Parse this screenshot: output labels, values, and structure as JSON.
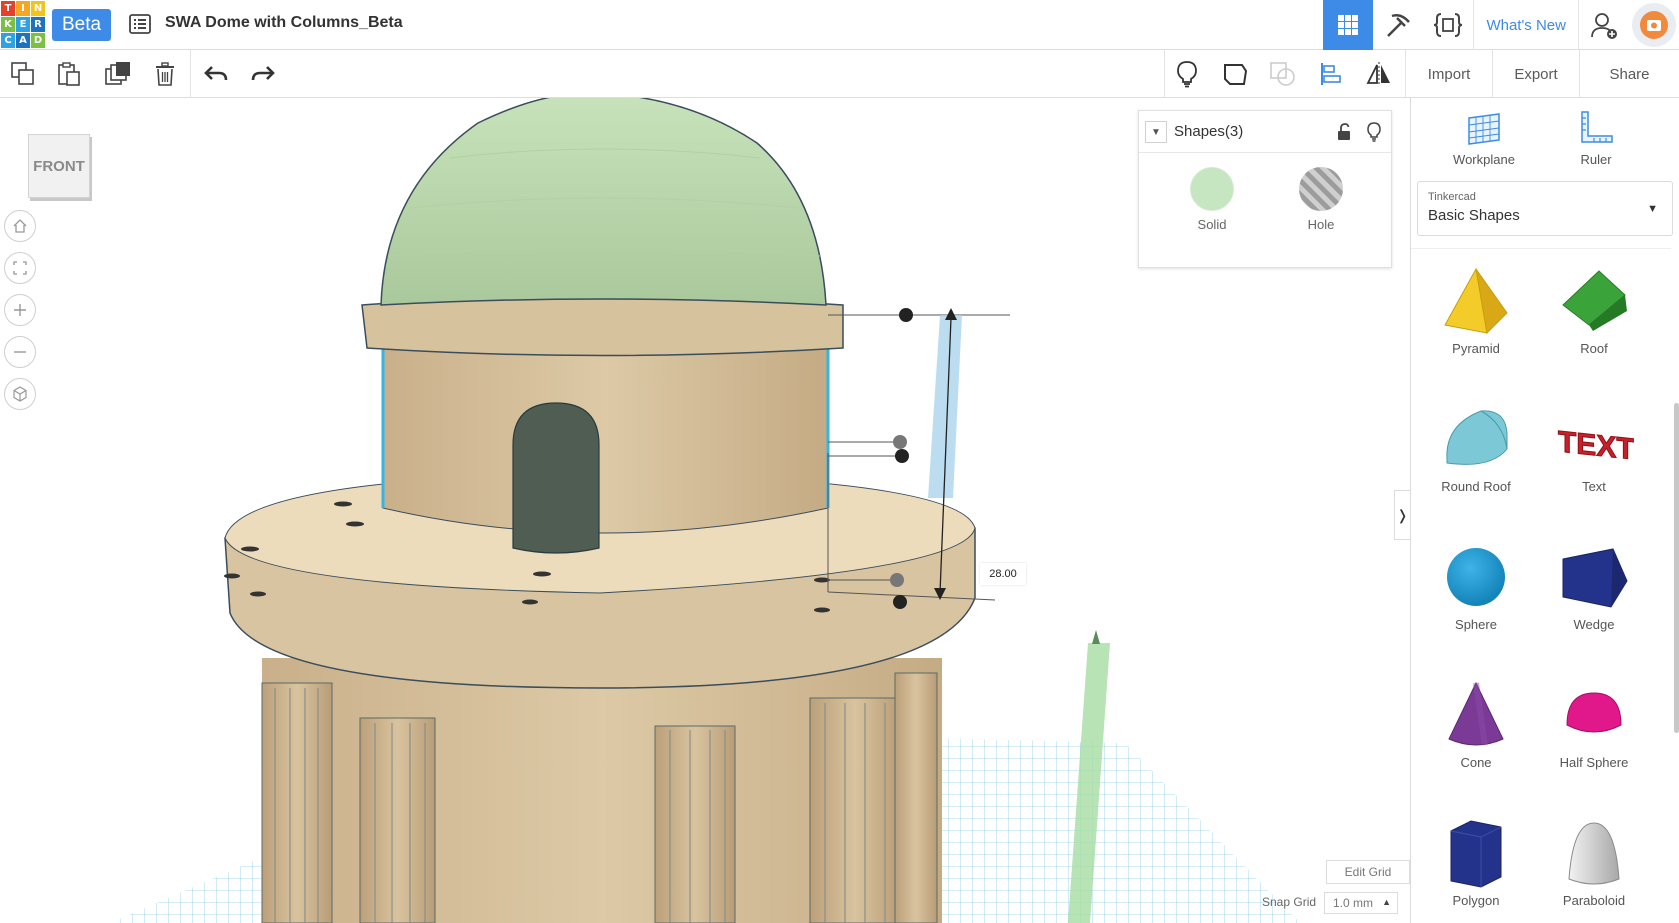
{
  "app": {
    "logo_letters": [
      "T",
      "I",
      "N",
      "K",
      "E",
      "R",
      "C",
      "A",
      "D"
    ],
    "beta_label": "Beta",
    "design_title": "SWA Dome with Columns_Beta"
  },
  "top_right": {
    "whats_new": "What's New"
  },
  "toolbar": {
    "import_label": "Import",
    "export_label": "Export",
    "share_label": "Share"
  },
  "viewport": {
    "view_cube_face": "FRONT",
    "dimension_value": "28.00",
    "edit_grid_label": "Edit Grid",
    "snap_grid_label": "Snap Grid",
    "snap_grid_value": "1.0 mm"
  },
  "inspector": {
    "title": "Shapes(3)",
    "solid_label": "Solid",
    "hole_label": "Hole"
  },
  "right_panel": {
    "workplane_label": "Workplane",
    "ruler_label": "Ruler",
    "library_owner": "Tinkercad",
    "library_name": "Basic Shapes",
    "shapes": [
      {
        "label": "Pyramid"
      },
      {
        "label": "Roof"
      },
      {
        "label": "Round Roof"
      },
      {
        "label": "Text"
      },
      {
        "label": "Sphere"
      },
      {
        "label": "Wedge"
      },
      {
        "label": "Cone"
      },
      {
        "label": "Half Sphere"
      },
      {
        "label": "Polygon"
      },
      {
        "label": "Paraboloid"
      }
    ]
  },
  "colors": {
    "accent": "#3d8be6",
    "dome": "#bfdcb0",
    "body": "#d6c19d",
    "grid": "#79c7e3",
    "solid": "#c6e6c1"
  }
}
